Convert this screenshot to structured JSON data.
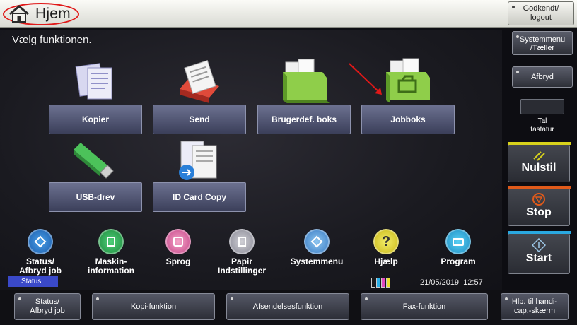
{
  "header": {
    "title": "Hjem",
    "logout_label": "Godkendt/\nlogout"
  },
  "main": {
    "prompt": "Vælg funktionen.",
    "functions": [
      {
        "label": "Kopier",
        "icon": "copy-documents-icon"
      },
      {
        "label": "Send",
        "icon": "send-documents-icon"
      },
      {
        "label": "Brugerdef. boks",
        "icon": "custom-box-icon"
      },
      {
        "label": "Jobboks",
        "icon": "job-box-icon"
      },
      {
        "label": "USB-drev",
        "icon": "usb-drive-icon"
      },
      {
        "label": "ID Card Copy",
        "icon": "id-card-copy-icon"
      }
    ],
    "shortcuts": [
      {
        "label": "Status/\nAfbryd job",
        "icon": "status-icon"
      },
      {
        "label": "Maskin-\ninformation",
        "icon": "machine-info-icon"
      },
      {
        "label": "Sprog",
        "icon": "language-icon"
      },
      {
        "label": "Papir\nIndstillinger",
        "icon": "paper-settings-icon"
      },
      {
        "label": "Systemmenu",
        "icon": "system-menu-icon"
      },
      {
        "label": "Hjælp",
        "icon": "help-icon"
      },
      {
        "label": "Program",
        "icon": "program-icon"
      }
    ],
    "status_tab": "Status",
    "datetime": "21/05/2019  12:57"
  },
  "right_panel": {
    "systemmenu_label": "Systemmenu\n/Tæller",
    "afbryd_label": "Afbryd",
    "tal_label": "Tal\ntastatur",
    "reset_label": "Nulstil",
    "stop_label": "Stop",
    "start_label": "Start"
  },
  "bottom": {
    "status_label": "Status/\nAfbryd job",
    "copy_label": "Kopi-funktion",
    "send_label": "Afsendelsesfunktion",
    "fax_label": "Fax-funktion",
    "accessibility_label": "Hlp. til handi-\ncap.-skærm"
  },
  "colors": {
    "accent_red": "#e01818",
    "reset_yellow": "#d8d21c",
    "stop_orange": "#e05a1a",
    "start_blue": "#2aa8e0",
    "status_tab_blue": "#3a49c9"
  }
}
